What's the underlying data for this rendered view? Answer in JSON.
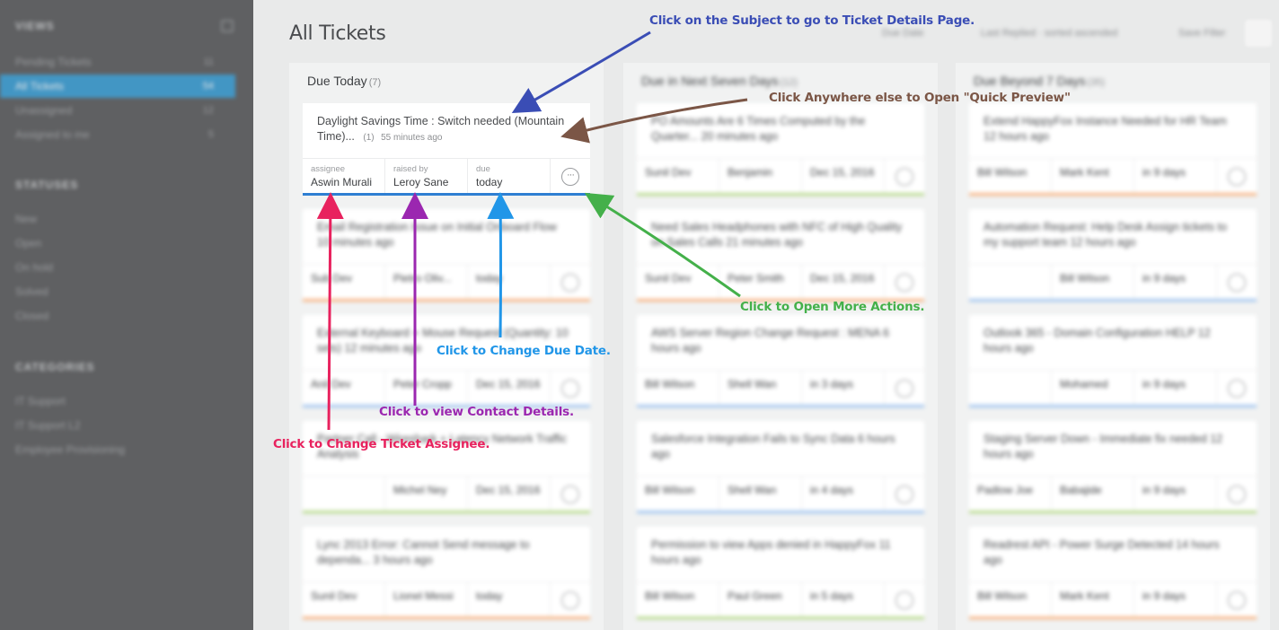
{
  "sidebar": {
    "section_views": "VIEWS",
    "section_statuses": "STATUSES",
    "section_categories": "CATEGORIES",
    "views": [
      {
        "label": "Pending Tickets",
        "count": "11"
      },
      {
        "label": "All Tickets",
        "count": "54"
      },
      {
        "label": "Unassigned",
        "count": "12"
      },
      {
        "label": "Assigned to me",
        "count": "5"
      }
    ],
    "statuses": [
      "New",
      "Open",
      "On hold",
      "Solved",
      "Closed"
    ],
    "categories": [
      "IT Support",
      "IT Support L2",
      "Employee Provisioning"
    ]
  },
  "header": {
    "title": "All Tickets",
    "sort_label": "Due Date",
    "filter_label": "Last Replied · sorted ascended",
    "view_label": "Save Filter"
  },
  "columns": [
    {
      "title": "Due Today",
      "count": "(7)"
    },
    {
      "title": "Due in Next Seven Days",
      "count": "(12)"
    },
    {
      "title": "Due Beyond 7 Days",
      "count": "(35)"
    }
  ],
  "focus_ticket": {
    "subject": "Daylight Savings Time : Switch needed (Mountain Time)...",
    "reply_count": "(1)",
    "time_ago": "55 minutes ago",
    "assignee_label": "assignee",
    "assignee": "Aswin Murali",
    "raised_by_label": "raised by",
    "raised_by": "Leroy Sane",
    "due_label": "due",
    "due": "today",
    "more_glyph": "···"
  },
  "background_tickets": {
    "col1": [
      {
        "subject": "Email Registration Issue on Initial Onboard Flow",
        "meta": "10 minutes ago",
        "a": "Sub Dev",
        "r": "Pietro Oliv...",
        "d": "today",
        "bar": "orange"
      },
      {
        "subject": "External Keyboard + Mouse Request (Quantity: 10 sets)",
        "meta": "12 minutes ago",
        "a": "Anil Dev",
        "r": "Peter Cropp",
        "d": "Dec 15, 2016",
        "bar": "lblue"
      },
      {
        "subject": "Partner Call - Wireshark + Latency Network Traffic Analysis",
        "meta": "",
        "a": "",
        "r": "Michel Ney",
        "d": "Dec 15, 2016",
        "bar": "green"
      },
      {
        "subject": "Lync 2013 Error: Cannot Send message to dependa...",
        "meta": "3 hours ago",
        "a": "Sunil Dev",
        "r": "Lionel Messi",
        "d": "today",
        "bar": "orange"
      }
    ],
    "col2": [
      {
        "subject": "PO Amounts Are 6 Times Computed by the Quarter...",
        "meta": "20 minutes ago",
        "a": "Sunil Dev",
        "r": "Benjamin",
        "d": "Dec 15, 2016",
        "bar": "green"
      },
      {
        "subject": "Need Sales Headphones with NFC of High Quality on Sales Calls",
        "meta": "21 minutes ago",
        "a": "Sunil Dev",
        "r": "Peter Smith",
        "d": "Dec 15, 2016",
        "bar": "orange"
      },
      {
        "subject": "AWS Server Region Change Request : MENA",
        "meta": "6 hours ago",
        "a": "Bill Wilson",
        "r": "Shell Wan",
        "d": "in 3 days",
        "bar": "lblue"
      },
      {
        "subject": "Salesforce Integration Fails to Sync Data",
        "meta": "6 hours ago",
        "a": "Bill Wilson",
        "r": "Shell Wan",
        "d": "in 4 days",
        "bar": "lblue"
      },
      {
        "subject": "Permission to view Apps denied in HappyFox",
        "meta": "11 hours ago",
        "a": "Bill Wilson",
        "r": "Paul Green",
        "d": "in 5 days",
        "bar": "green"
      }
    ],
    "col3": [
      {
        "subject": "Extend HappyFox Instance Needed for HR Team",
        "meta": "12 hours ago",
        "a": "Bill Wilson",
        "r": "Mark Kent",
        "d": "in 9 days",
        "bar": "orange"
      },
      {
        "subject": "Automation Request: Help Desk Assign tickets to my support team",
        "meta": "12 hours ago",
        "a": "",
        "r": "Bill Wilson",
        "d": "in 9 days",
        "bar": "lblue"
      },
      {
        "subject": "Outlook 365 - Domain Configuration HELP",
        "meta": "12 hours ago",
        "a": "",
        "r": "Mohamed",
        "d": "in 9 days",
        "bar": "lblue"
      },
      {
        "subject": "Staging Server Down - Immediate fix needed",
        "meta": "12 hours ago",
        "a": "Padlow Joe",
        "r": "Babajide",
        "d": "in 9 days",
        "bar": "green"
      },
      {
        "subject": "Readrest API - Power Surge Detected",
        "meta": "14 hours ago",
        "a": "Bill Wilson",
        "r": "Mark Kent",
        "d": "in 9 days",
        "bar": "orange"
      }
    ]
  },
  "annotations": {
    "subject_hint": "Click on the Subject to go to Ticket Details Page.",
    "preview_hint": "Click Anywhere else to Open \"Quick Preview\"",
    "more_actions_hint": "Click to Open More Actions.",
    "due_date_hint": "Click to Change Due Date.",
    "contact_hint": "Click to view Contact Details.",
    "assignee_hint": "Click to Change Ticket Assignee.",
    "colors": {
      "subject": "#3a4db5",
      "preview": "#7b5646",
      "more_actions": "#44b04a",
      "due_date": "#2196e8",
      "contact": "#9b27b0",
      "assignee": "#e8225e"
    }
  }
}
